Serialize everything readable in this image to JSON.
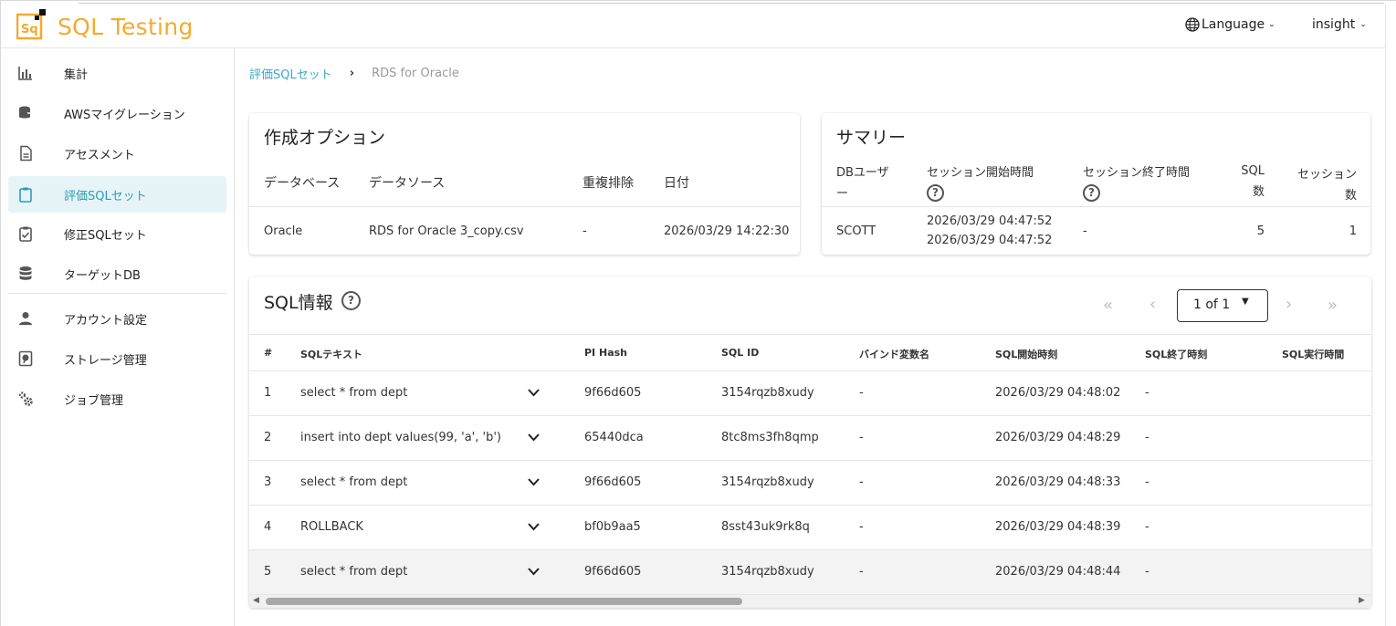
{
  "app": {
    "title": "SQL Testing"
  },
  "header": {
    "language_label": "Language",
    "user_label": "insight"
  },
  "sidebar": {
    "items": [
      {
        "label": "集計",
        "icon": "bar-chart-icon"
      },
      {
        "label": "AWSマイグレーション",
        "icon": "database-export-icon"
      },
      {
        "label": "アセスメント",
        "icon": "document-icon"
      },
      {
        "label": "評価SQLセット",
        "icon": "clipboard-icon",
        "active": true
      },
      {
        "label": "修正SQLセット",
        "icon": "clipboard-check-icon"
      },
      {
        "label": "ターゲットDB",
        "icon": "database-icon"
      },
      {
        "label": "アカウント設定",
        "icon": "person-icon"
      },
      {
        "label": "ストレージ管理",
        "icon": "storage-icon"
      },
      {
        "label": "ジョブ管理",
        "icon": "gears-icon"
      }
    ]
  },
  "breadcrumb": {
    "link": "評価SQLセット",
    "current": "RDS for Oracle"
  },
  "options": {
    "title": "作成オプション",
    "headers": [
      "データベース",
      "データソース",
      "重複排除",
      "日付"
    ],
    "values": [
      "Oracle",
      "RDS for Oracle 3_copy.csv",
      "-",
      "2026/03/29 14:22:30"
    ]
  },
  "summary": {
    "title": "サマリー",
    "headers": {
      "db_user_1": "DBユーザ",
      "db_user_2": "ー",
      "start": "セッション開始時間",
      "end": "セッション終了時間",
      "sql_1": "SQL",
      "sql_2": "数",
      "session_1": "セッション",
      "session_2": "数"
    },
    "values": {
      "db_user": "SCOTT",
      "start_1": "2026/03/29 04:47:52",
      "start_2": "2026/03/29 04:47:52",
      "end": "-",
      "sql_count": "5",
      "session_count": "1"
    }
  },
  "sql_info": {
    "title": "SQL情報",
    "pager": {
      "page_label": "1 of 1"
    },
    "columns": [
      "#",
      "SQLテキスト",
      "PI Hash",
      "SQL ID",
      "バインド変数名",
      "SQL開始時刻",
      "SQL終了時刻",
      "SQL実行時間"
    ],
    "rows": [
      {
        "num": "1",
        "text": "select * from dept",
        "hash": "9f66d605",
        "sql_id": "3154rqzb8xudy",
        "bind": "-",
        "start": "2026/03/29 04:48:02",
        "end": "-"
      },
      {
        "num": "2",
        "text": "insert into dept values(99, 'a', 'b')",
        "hash": "65440dca",
        "sql_id": "8tc8ms3fh8qmp",
        "bind": "-",
        "start": "2026/03/29 04:48:29",
        "end": "-"
      },
      {
        "num": "3",
        "text": "select * from dept",
        "hash": "9f66d605",
        "sql_id": "3154rqzb8xudy",
        "bind": "-",
        "start": "2026/03/29 04:48:33",
        "end": "-"
      },
      {
        "num": "4",
        "text": "ROLLBACK",
        "hash": "bf0b9aa5",
        "sql_id": "8sst43uk9rk8q",
        "bind": "-",
        "start": "2026/03/29 04:48:39",
        "end": "-"
      },
      {
        "num": "5",
        "text": "select * from dept",
        "hash": "9f66d605",
        "sql_id": "3154rqzb8xudy",
        "bind": "-",
        "start": "2026/03/29 04:48:44",
        "end": "-"
      }
    ]
  },
  "colors": {
    "brand": "#f3ab2c",
    "accent": "#2b9cb9",
    "active_bg": "#e6f4f7"
  }
}
